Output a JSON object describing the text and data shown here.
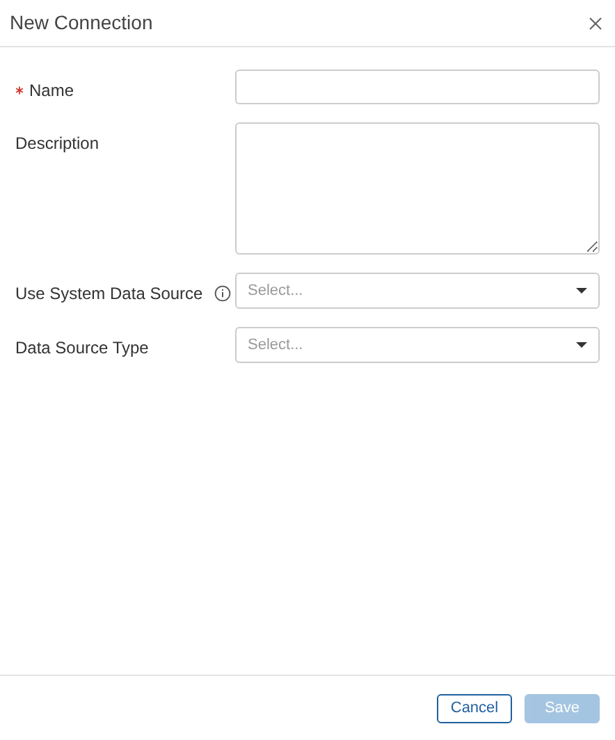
{
  "dialog": {
    "title": "New Connection"
  },
  "fields": [
    {
      "label": "Name",
      "kind": "text",
      "required": true,
      "info": false
    },
    {
      "label": "Description",
      "kind": "textarea",
      "required": false,
      "info": false
    },
    {
      "label": "Use System Data Source",
      "kind": "select",
      "placeholder": "Select...",
      "required": false,
      "info": true
    },
    {
      "label": "Data Source Type",
      "kind": "select",
      "placeholder": "Select...",
      "required": false,
      "info": false
    }
  ],
  "buttons": [
    {
      "label": "Cancel",
      "kind": "secondary",
      "disabled": false
    },
    {
      "label": "Save",
      "kind": "primary",
      "disabled": true
    }
  ]
}
